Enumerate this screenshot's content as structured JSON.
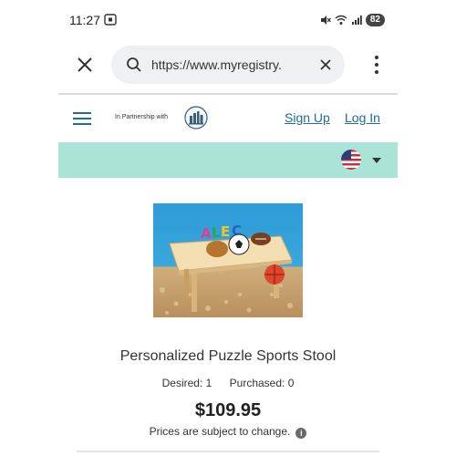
{
  "status_bar": {
    "time": "11:27",
    "battery": "82"
  },
  "browser": {
    "url": "https://www.myregistry.",
    "icons": [
      "close-icon",
      "search-icon",
      "clear-icon",
      "more-vert-icon"
    ]
  },
  "site_header": {
    "partner_text": "In Partnership with",
    "signup_label": "Sign Up",
    "login_label": "Log In"
  },
  "locale": {
    "flag": "us-flag-icon"
  },
  "product": {
    "title": "Personalized Puzzle Sports Stool",
    "desired": "Desired: 1",
    "purchased": "Purchased: 0",
    "price": "$109.95",
    "price_note": "Prices are subject to change.",
    "image_alt": "Personalized puzzle stool with name letters and sports balls"
  },
  "colors": {
    "accent_link": "#1f6c9c",
    "teal_band": "#a9e4d7",
    "url_pill": "#eef0f3"
  }
}
